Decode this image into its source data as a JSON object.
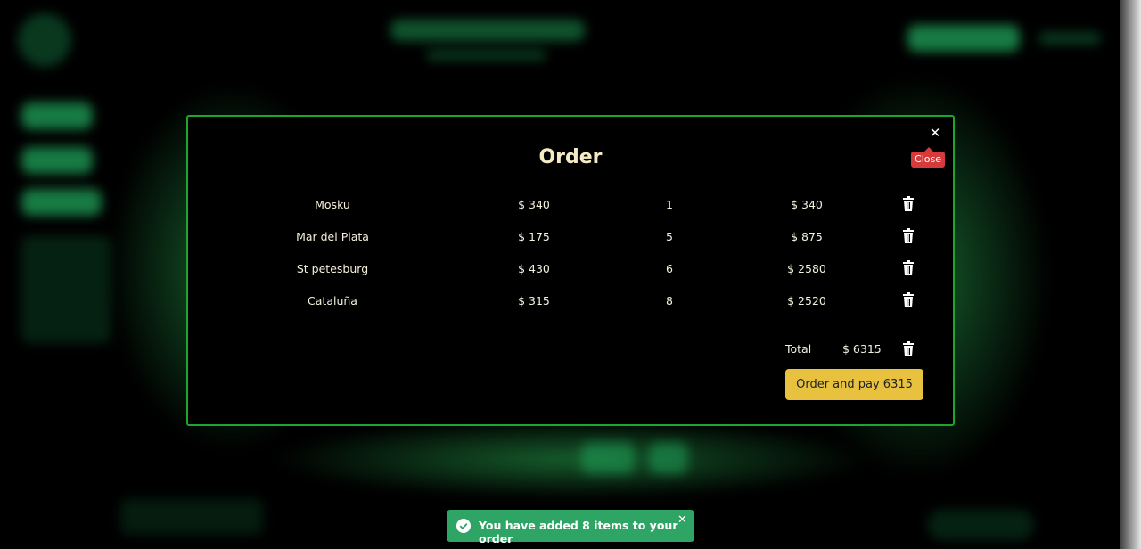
{
  "modal": {
    "title": "Order",
    "close_icon": "close-icon",
    "close_tooltip": "Close",
    "items": [
      {
        "name": "Mosku",
        "price": "$ 340",
        "qty": "1",
        "subtotal": "$ 340"
      },
      {
        "name": "Mar del Plata",
        "price": "$ 175",
        "qty": "5",
        "subtotal": "$ 875"
      },
      {
        "name": "St petesburg",
        "price": "$ 430",
        "qty": "6",
        "subtotal": "$ 2580"
      },
      {
        "name": "Cataluña",
        "price": "$ 315",
        "qty": "8",
        "subtotal": "$ 2520"
      }
    ],
    "total_label": "Total",
    "total_value": "$ 6315",
    "pay_button": "Order and pay 6315"
  },
  "toast": {
    "message": "You have added 8 items to your order",
    "close_icon": "close-icon"
  },
  "colors": {
    "modal_border": "#1ea52b",
    "pay_button": "#e8c23f",
    "tooltip": "#d73a3a",
    "toast": "#2ea565",
    "text": "#f4eac3"
  }
}
